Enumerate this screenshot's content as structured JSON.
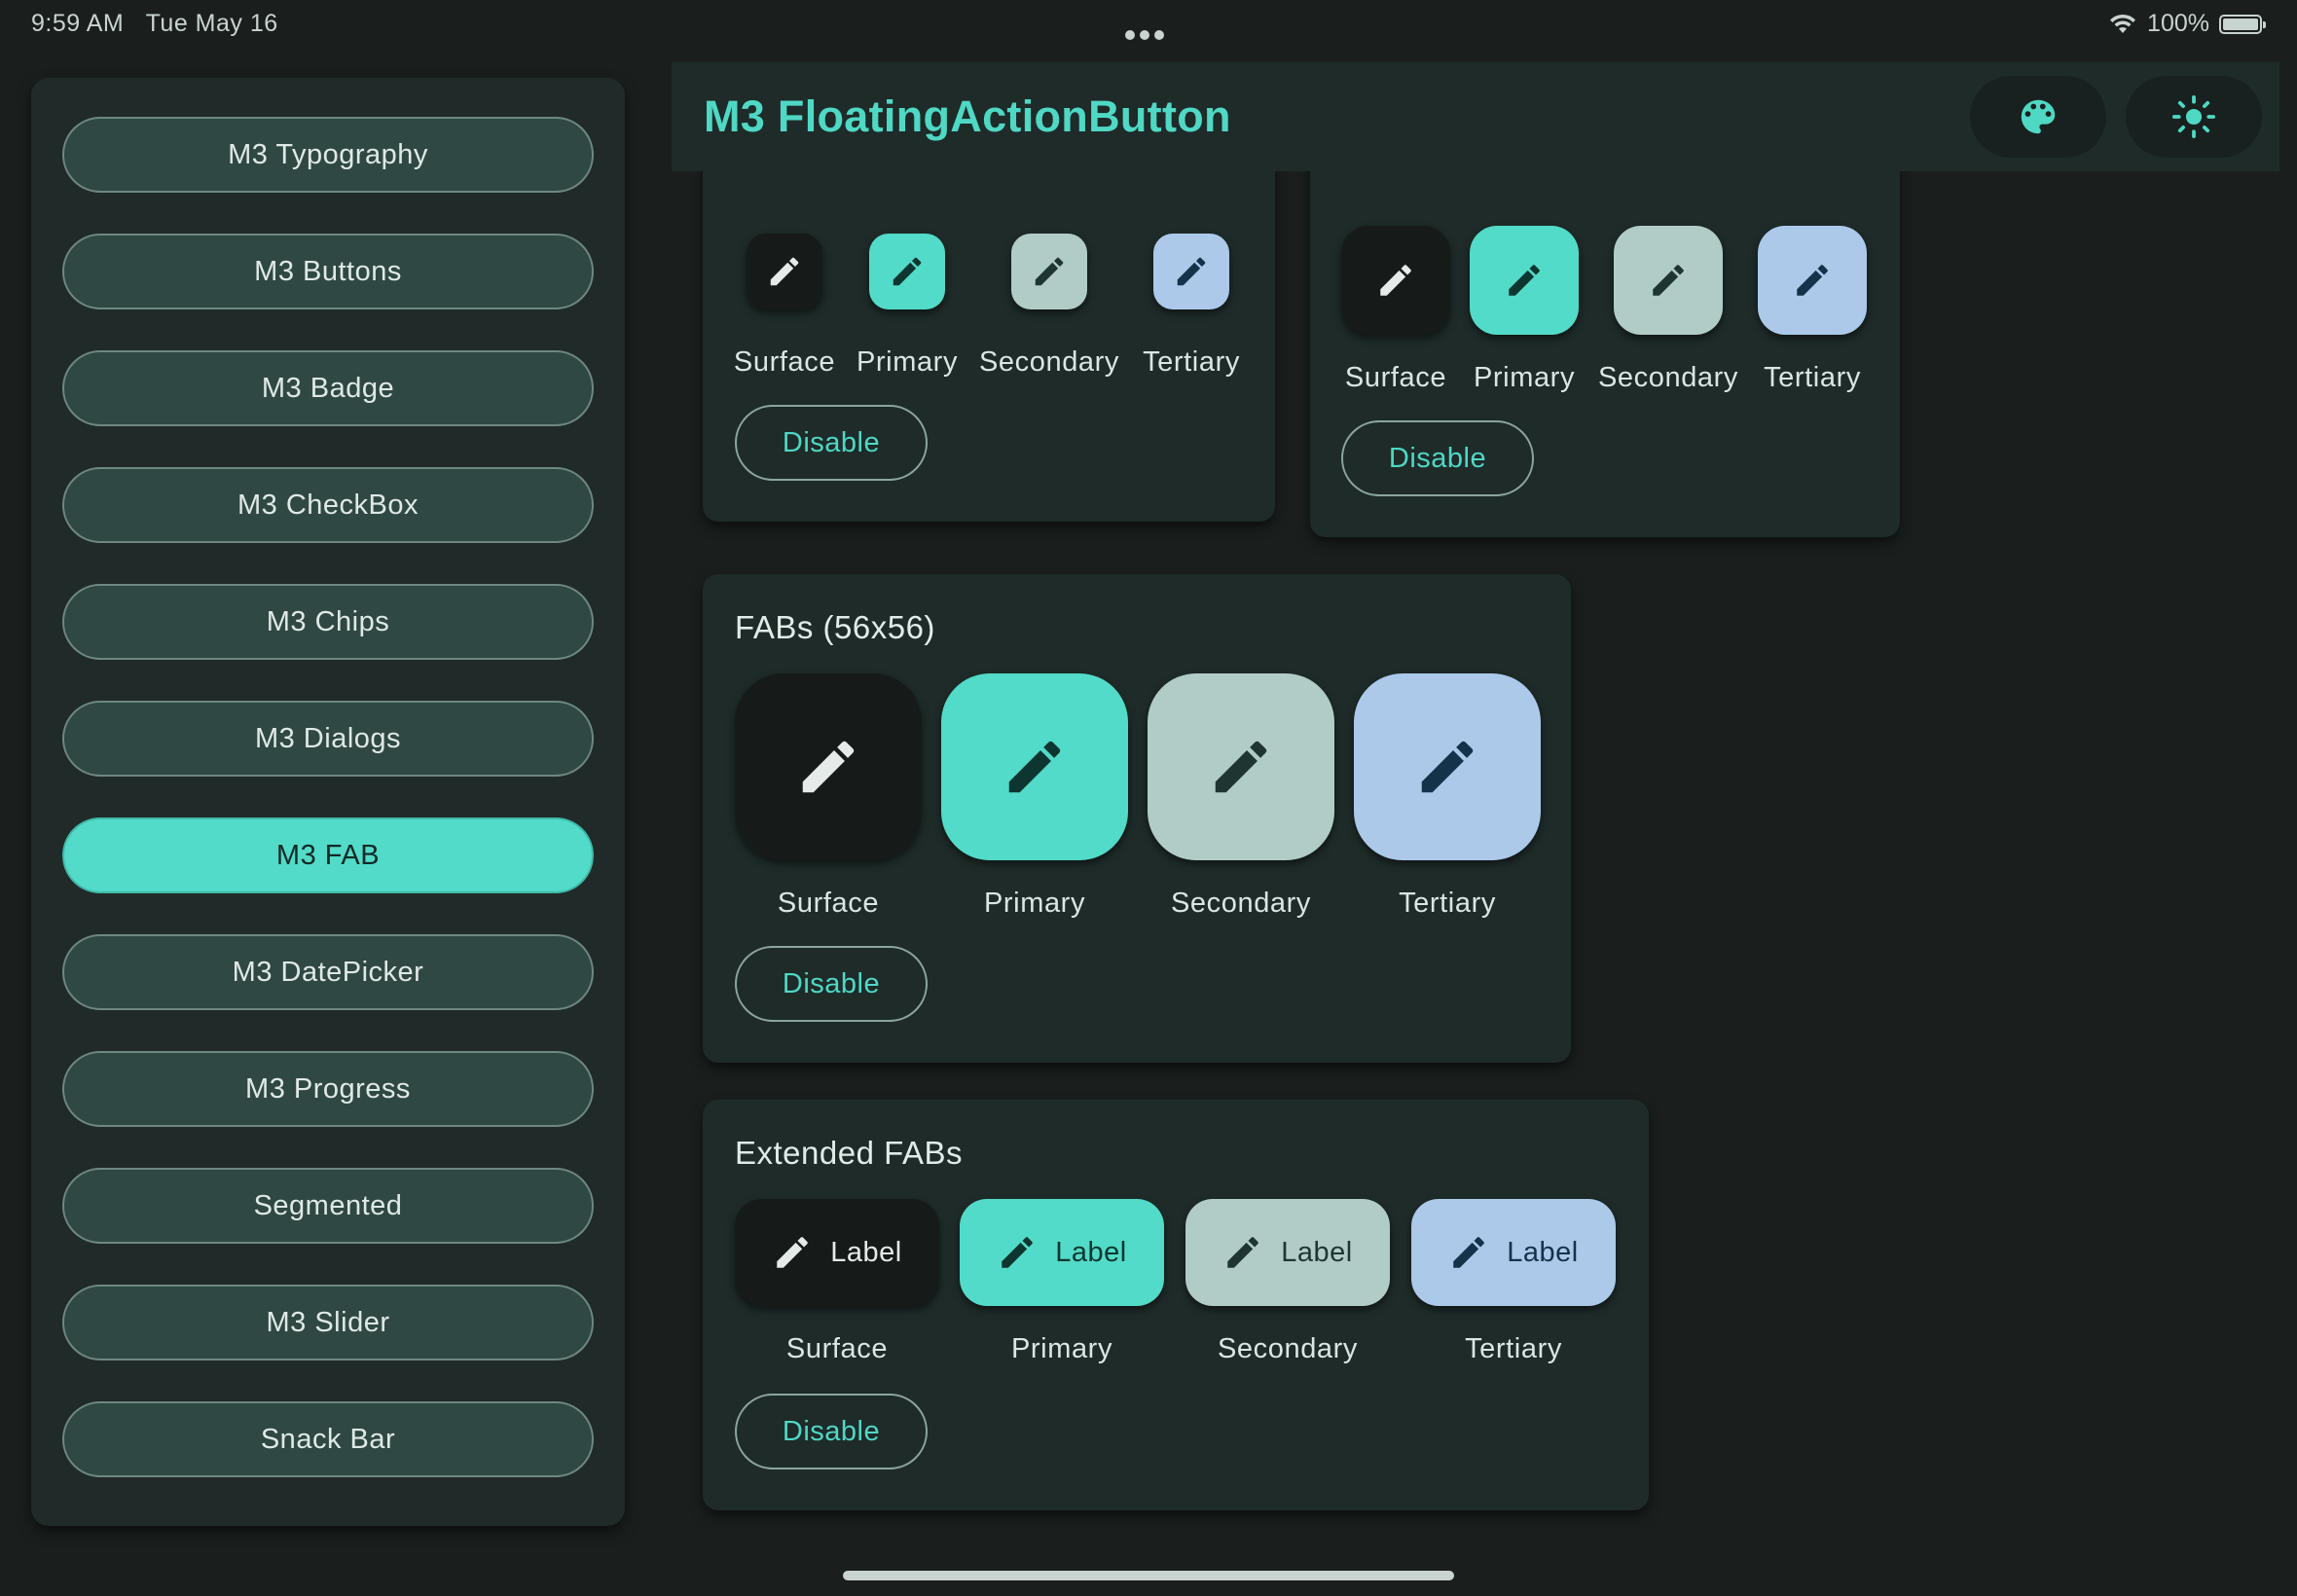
{
  "status_bar": {
    "time": "9:59 AM",
    "date": "Tue May 16",
    "battery": "100%",
    "icons": [
      "wifi-icon",
      "battery-icon",
      "more-dots-icon"
    ]
  },
  "sidebar": {
    "items": [
      {
        "label": "M3 Typography",
        "active": false
      },
      {
        "label": "M3 Buttons",
        "active": false
      },
      {
        "label": "M3 Badge",
        "active": false
      },
      {
        "label": "M3 CheckBox",
        "active": false
      },
      {
        "label": "M3 Chips",
        "active": false
      },
      {
        "label": "M3 Dialogs",
        "active": false
      },
      {
        "label": "M3 FAB",
        "active": true
      },
      {
        "label": "M3 DatePicker",
        "active": false
      },
      {
        "label": "M3 Progress",
        "active": false
      },
      {
        "label": "Segmented",
        "active": false
      },
      {
        "label": "M3 Slider",
        "active": false
      },
      {
        "label": "Snack Bar",
        "active": false
      }
    ]
  },
  "appbar": {
    "title": "M3 FloatingActionButton",
    "actions": [
      "palette-icon",
      "brightness-icon"
    ]
  },
  "variants": [
    "Surface",
    "Primary",
    "Secondary",
    "Tertiary"
  ],
  "cards": {
    "small": {
      "disable_label": "Disable"
    },
    "medium": {
      "disable_label": "Disable"
    },
    "large": {
      "title": "FABs (56x56)",
      "disable_label": "Disable"
    },
    "extended": {
      "title": "Extended FABs",
      "fab_label": "Label",
      "disable_label": "Disable"
    }
  },
  "colors": {
    "background": "#1a1f1e",
    "card": "#1e2b29",
    "primary": "#52dbc8",
    "secondary": "#b1ccc6",
    "tertiary": "#acc9ea",
    "surface": "#161b1a"
  }
}
